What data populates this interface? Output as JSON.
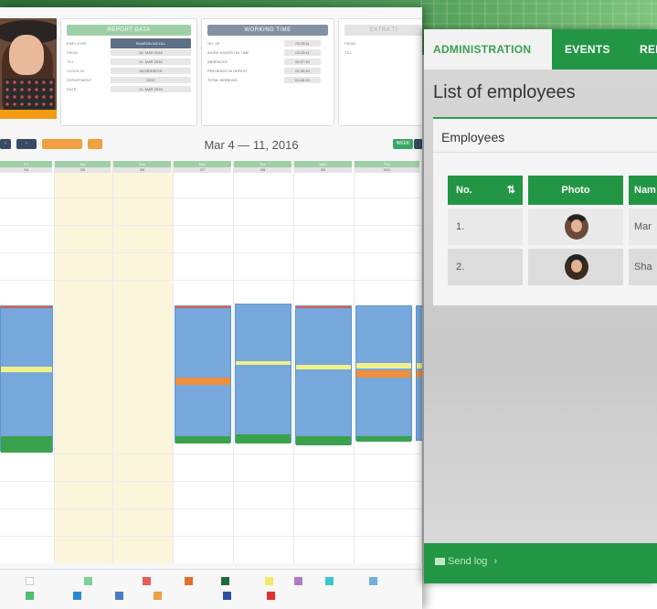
{
  "calendar": {
    "cards": {
      "report": {
        "title": "REPORT DATA",
        "rows": [
          {
            "label": "EMPLOYEE",
            "value": "SHARON NICOLL"
          },
          {
            "label": "FROM",
            "value": "04. MAR 2016"
          },
          {
            "label": "TILL",
            "value": "11. MAR 2016"
          },
          {
            "label": "CLOCK-IN",
            "value": "DEVERSEGS"
          },
          {
            "label": "DEPARTMENT",
            "value": "ISSO"
          },
          {
            "label": "DATE",
            "value": "11. MAR 2016"
          }
        ]
      },
      "working": {
        "title": "WORKING TIME",
        "rows": [
          {
            "label": "NO. OF",
            "value": "00:29:11"
          },
          {
            "label": "WORK HOURS ON TIME",
            "value": "00:29:11"
          },
          {
            "label": "ABSENCES",
            "value": "00:07:16"
          },
          {
            "label": "PRESENCE IN DEFICIT",
            "value": "01:00:10"
          },
          {
            "label": "TOTAL WORKING",
            "value": "00:28:15"
          }
        ]
      },
      "extra": {
        "title": "EXTRA TI",
        "rows": [
          {
            "label": "FROM"
          },
          {
            "label": "TILL"
          }
        ]
      }
    },
    "toolbar": {
      "prev": "‹",
      "next": "›",
      "btn1": "",
      "btn2": "",
      "title": "Mar 4 — 11, 2016",
      "week": "WEEK",
      "week2": ""
    },
    "days": [
      {
        "name": "Fri",
        "date": "3/4"
      },
      {
        "name": "Sat",
        "date": "3/5"
      },
      {
        "name": "Sun",
        "date": "3/6"
      },
      {
        "name": "Mon",
        "date": "3/7"
      },
      {
        "name": "Tue",
        "date": "3/8"
      },
      {
        "name": "Wed",
        "date": "3/9"
      },
      {
        "name": "Thu",
        "date": "3/10"
      }
    ],
    "legend": [
      {
        "label": "",
        "color": "#ffffff"
      },
      {
        "label": "",
        "color": "#7fcf99"
      },
      {
        "label": "",
        "color": "#e75b5b"
      },
      {
        "label": "",
        "color": "#e07030"
      },
      {
        "label": "",
        "color": "#1f6a3b"
      },
      {
        "label": "",
        "color": "#f2e66b"
      },
      {
        "label": "",
        "color": "#b07cc6"
      },
      {
        "label": "",
        "color": "#3cc6cf"
      },
      {
        "label": "",
        "color": "#71aee0"
      },
      {
        "label": "",
        "color": "#4cc06b"
      },
      {
        "label": "",
        "color": "#2a8ad4"
      },
      {
        "label": "",
        "color": "#4a7cc6"
      },
      {
        "label": "",
        "color": "#f0a040"
      },
      {
        "label": "",
        "color": "#2f4f9f"
      },
      {
        "label": "",
        "color": "#e03030"
      }
    ]
  },
  "admin": {
    "tabs": {
      "administration": "ADMINISTRATION",
      "events": "EVENTS",
      "reports": "REP"
    },
    "page_title": "List of employees",
    "section_title": "Employees",
    "table": {
      "headers": {
        "no": "No.",
        "photo": "Photo",
        "name": "Nam"
      },
      "sort_icon": "sort-icon",
      "rows": [
        {
          "no": "1.",
          "name": "Mar"
        },
        {
          "no": "2.",
          "name": "Sha"
        }
      ]
    },
    "footer": {
      "send_log": "Send log",
      "arrow": "›"
    }
  }
}
